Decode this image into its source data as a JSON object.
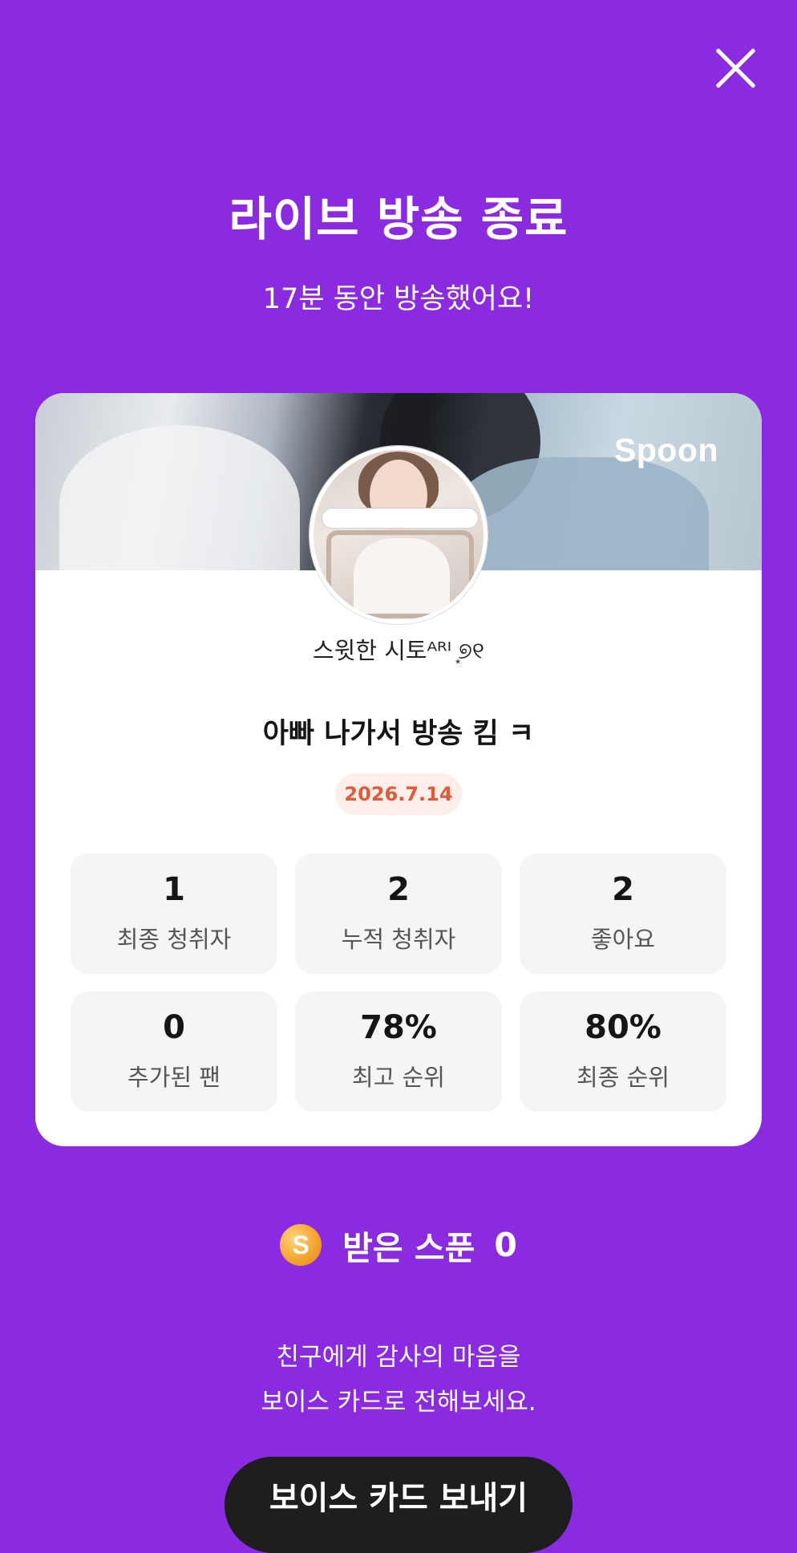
{
  "header": {
    "title": "라이브 방송 종료",
    "subtitle": "17분 동안 방송했어요!"
  },
  "card": {
    "brand": "Spoon",
    "username": "스윗한 시토ᴬᴿᴵ ͙୭୧",
    "broadcast_title": "아빠 나가서 방송 킴 ㅋ",
    "date": "2026.7.14",
    "stats": [
      {
        "value": "1",
        "label": "최종 청취자"
      },
      {
        "value": "2",
        "label": "누적 청취자"
      },
      {
        "value": "2",
        "label": "좋아요"
      },
      {
        "value": "0",
        "label": "추가된 팬"
      },
      {
        "value": "78%",
        "label": "최고 순위"
      },
      {
        "value": "80%",
        "label": "최종 순위"
      }
    ]
  },
  "spoons": {
    "coin_letter": "S",
    "label": "받은 스푼",
    "count": "0"
  },
  "thanks": {
    "line1": "친구에게 감사의 마음을",
    "line2": "보이스 카드로 전해보세요."
  },
  "action": {
    "voice_card_label": "보이스 카드 보내기"
  },
  "colors": {
    "background": "#8a2be2",
    "date_badge_text": "#e05a3a",
    "button": "#1e1e1e"
  }
}
